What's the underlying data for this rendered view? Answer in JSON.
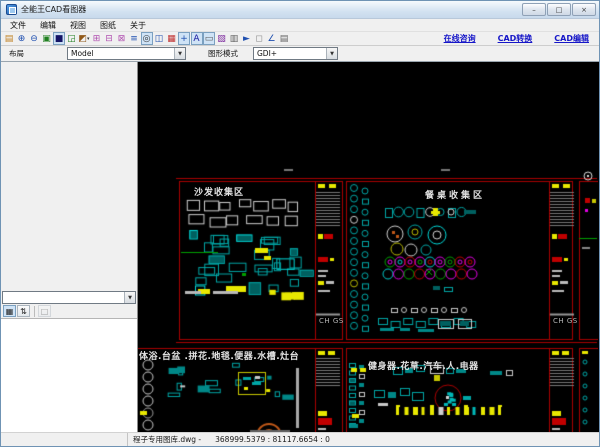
{
  "window": {
    "title": "全能王CAD看图器",
    "controls": {
      "minimize": "–",
      "maximize": "□",
      "close": "×"
    }
  },
  "menu": {
    "items": [
      {
        "name": "file",
        "label": "文件"
      },
      {
        "name": "edit",
        "label": "编辑"
      },
      {
        "name": "view",
        "label": "视图"
      },
      {
        "name": "sheet",
        "label": "图纸"
      },
      {
        "name": "about",
        "label": "关于"
      }
    ]
  },
  "toolbar": {
    "icons": [
      {
        "name": "open-file",
        "glyph": "▤",
        "color": "#c08020"
      },
      {
        "name": "zoom-in",
        "glyph": "⊕",
        "color": "#2050b0"
      },
      {
        "name": "zoom-out",
        "glyph": "⊖",
        "color": "#2050b0"
      },
      {
        "name": "zoom-extents",
        "glyph": "▣",
        "color": "#208020"
      },
      {
        "name": "background-toggle",
        "glyph": "■",
        "color": "#141466",
        "pressed": true
      },
      {
        "name": "regen-view",
        "glyph": "◲",
        "color": "#208020"
      },
      {
        "name": "palette",
        "glyph": "◩",
        "color": "#905818",
        "dropdown": true
      },
      {
        "name": "prev-view",
        "glyph": "⊞",
        "color": "#b050b0"
      },
      {
        "name": "next-view",
        "glyph": "⊟",
        "color": "#b050b0"
      },
      {
        "name": "mirror-view",
        "glyph": "⊠",
        "color": "#b050b0"
      },
      {
        "name": "layer-list",
        "glyph": "≡",
        "color": "#2050b0"
      },
      {
        "name": "orbit",
        "glyph": "◎",
        "color": "#333333",
        "pressed": true
      },
      {
        "name": "viewport-tiles",
        "glyph": "◫",
        "color": "#2050b0"
      },
      {
        "name": "layer-colors",
        "glyph": "▦",
        "color": "#c03030"
      },
      {
        "name": "pan",
        "glyph": "+",
        "color": "#2050b0",
        "pressed": true
      },
      {
        "name": "text-toggle",
        "glyph": "A",
        "color": "#1818a0",
        "pressed": true
      },
      {
        "name": "measure",
        "glyph": "▭",
        "color": "#555555",
        "pressed": true
      },
      {
        "name": "line-width",
        "glyph": "▧",
        "color": "#8030a0"
      },
      {
        "name": "print",
        "glyph": "▥",
        "color": "#606060"
      },
      {
        "name": "select",
        "glyph": "►",
        "color": "#2050b0"
      },
      {
        "name": "zoom-window",
        "glyph": "◻",
        "color": "#888888"
      },
      {
        "name": "measure-angle",
        "glyph": "∠",
        "color": "#2050b0"
      },
      {
        "name": "copy",
        "glyph": "▤",
        "color": "#606060"
      }
    ],
    "links": [
      {
        "name": "online-consult",
        "label": "在线咨询"
      },
      {
        "name": "cad-convert",
        "label": "CAD转换"
      },
      {
        "name": "cad-edit",
        "label": "CAD编辑"
      }
    ]
  },
  "layout_bar": {
    "layout_label": "布局",
    "layout_value": "Model",
    "mode_label": "图形模式",
    "mode_value": "GDI+"
  },
  "left_panel": {
    "combo_value": "",
    "buttons": [
      {
        "name": "categorized",
        "glyph": "▦",
        "pressed": true
      },
      {
        "name": "sort-alphabetical",
        "glyph": "⇅"
      },
      {
        "name": "detail-page",
        "glyph": "□",
        "disabled": true
      }
    ]
  },
  "canvas": {
    "sections": [
      {
        "name": "sofa",
        "title": "沙发收集区",
        "corner_label": "CH GS"
      },
      {
        "name": "dining",
        "title": "餐桌收集区",
        "corner_label": "CH GS"
      },
      {
        "name": "bath",
        "title": "体浴.台盆 .拼花.地毯.便器.水槽.灶台"
      },
      {
        "name": "fitness",
        "title": "健身器.花草.汽车.人.电器"
      }
    ]
  },
  "status_bar": {
    "filename": "程子专用图库.dwg -",
    "coordinates": "368999.5379 : 81117.6654 : 0"
  },
  "colors": {
    "link": "#1616c8",
    "section_border": "#aa0000",
    "cad_cyan": "#00a6a6",
    "cad_cyan_bright": "#00d8d8",
    "cad_cyan_fill": "#006060",
    "cad_yellow": "#e8e800",
    "cad_magenta": "#e000e0",
    "cad_green": "#00a000",
    "cad_red": "#c00000",
    "cad_white": "#d0d0d0",
    "cad_orange": "#c05818"
  }
}
